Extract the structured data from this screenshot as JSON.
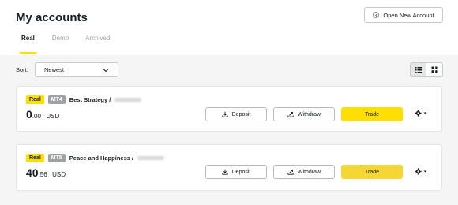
{
  "header": {
    "title": "My accounts",
    "open_account_label": "Open New Account"
  },
  "tabs": [
    {
      "label": "Real",
      "active": true
    },
    {
      "label": "Demo",
      "active": false
    },
    {
      "label": "Archived",
      "active": false
    }
  ],
  "sort": {
    "label": "Sort:",
    "selected": "Newest"
  },
  "view": {
    "mode": "list",
    "options": [
      "list-view-icon",
      "grid-view-icon"
    ]
  },
  "accounts": [
    {
      "type_badge": "Real",
      "platform": "MT4",
      "name": "Best Strategy /",
      "balance_int": "0",
      "balance_dec": ".00",
      "currency": "USD",
      "deposit_label": "Deposit",
      "withdraw_label": "Withdraw",
      "trade_label": "Trade"
    },
    {
      "type_badge": "Real",
      "platform": "MT5",
      "name": "Peace and Happiness /",
      "balance_int": "40",
      "balance_dec": ".56",
      "currency": "USD",
      "deposit_label": "Deposit",
      "withdraw_label": "Withdraw",
      "trade_label": "Trade"
    }
  ],
  "colors": {
    "accent": "#ffde02",
    "text": "#141d22",
    "muted": "#a0a4a8",
    "platform_badge": "#9ea1a4"
  }
}
